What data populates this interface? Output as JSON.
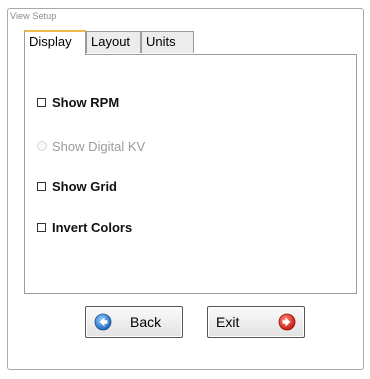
{
  "window": {
    "title": "View Setup"
  },
  "tabs": [
    {
      "label": "Display",
      "active": true
    },
    {
      "label": "Layout",
      "active": false
    },
    {
      "label": "Units",
      "active": false
    }
  ],
  "options": [
    {
      "label": "Show RPM",
      "control": "checkbox",
      "checked": false,
      "enabled": true
    },
    {
      "label": "Show Digital KV",
      "control": "radio",
      "checked": false,
      "enabled": false
    },
    {
      "label": "Show Grid",
      "control": "checkbox",
      "checked": false,
      "enabled": true
    },
    {
      "label": "Invert Colors",
      "control": "checkbox",
      "checked": false,
      "enabled": true
    }
  ],
  "buttons": {
    "back": {
      "label": "Back",
      "icon": "arrow-left-icon",
      "icon_color": "#2f7fd0"
    },
    "exit": {
      "label": "Exit",
      "icon": "arrow-right-icon",
      "icon_color": "#e0281c"
    }
  }
}
